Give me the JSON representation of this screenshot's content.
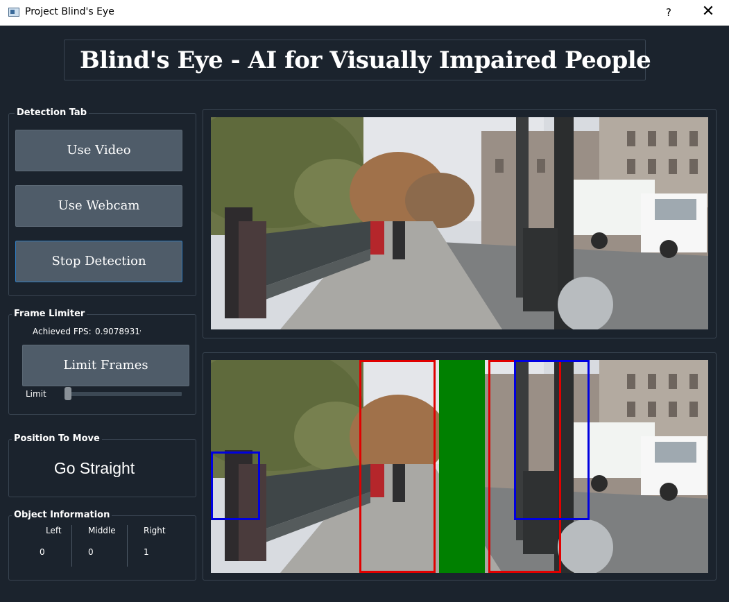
{
  "window": {
    "title": "Project Blind's Eye",
    "help_label": "?",
    "close_label": "✕"
  },
  "heading": "Blind's Eye - AI for Visually Impaired People",
  "detection_tab": {
    "title": "Detection Tab",
    "use_video": "Use Video",
    "use_webcam": "Use Webcam",
    "stop_detection": "Stop Detection"
  },
  "frame_limiter": {
    "title": "Frame Limiter",
    "fps_label": "Achieved FPS:",
    "fps_value": "0.9078931€",
    "limit_button": "Limit Frames",
    "slider_label": "Limit",
    "slider_value_fraction": 0.0
  },
  "position": {
    "title": "Position To Move",
    "value": "Go Straight"
  },
  "object_info": {
    "title": "Object Information",
    "headers": [
      "Left",
      "Middle",
      "Right"
    ],
    "values": [
      "0",
      "0",
      "1"
    ]
  },
  "colors": {
    "background": "#1b232d",
    "button": "#4f5c69",
    "box_red": "#e00000",
    "box_blue": "#0000e0",
    "box_green": "#008000"
  },
  "icons": {
    "app": "window-app-icon",
    "help": "question-mark-icon",
    "close": "close-icon"
  }
}
